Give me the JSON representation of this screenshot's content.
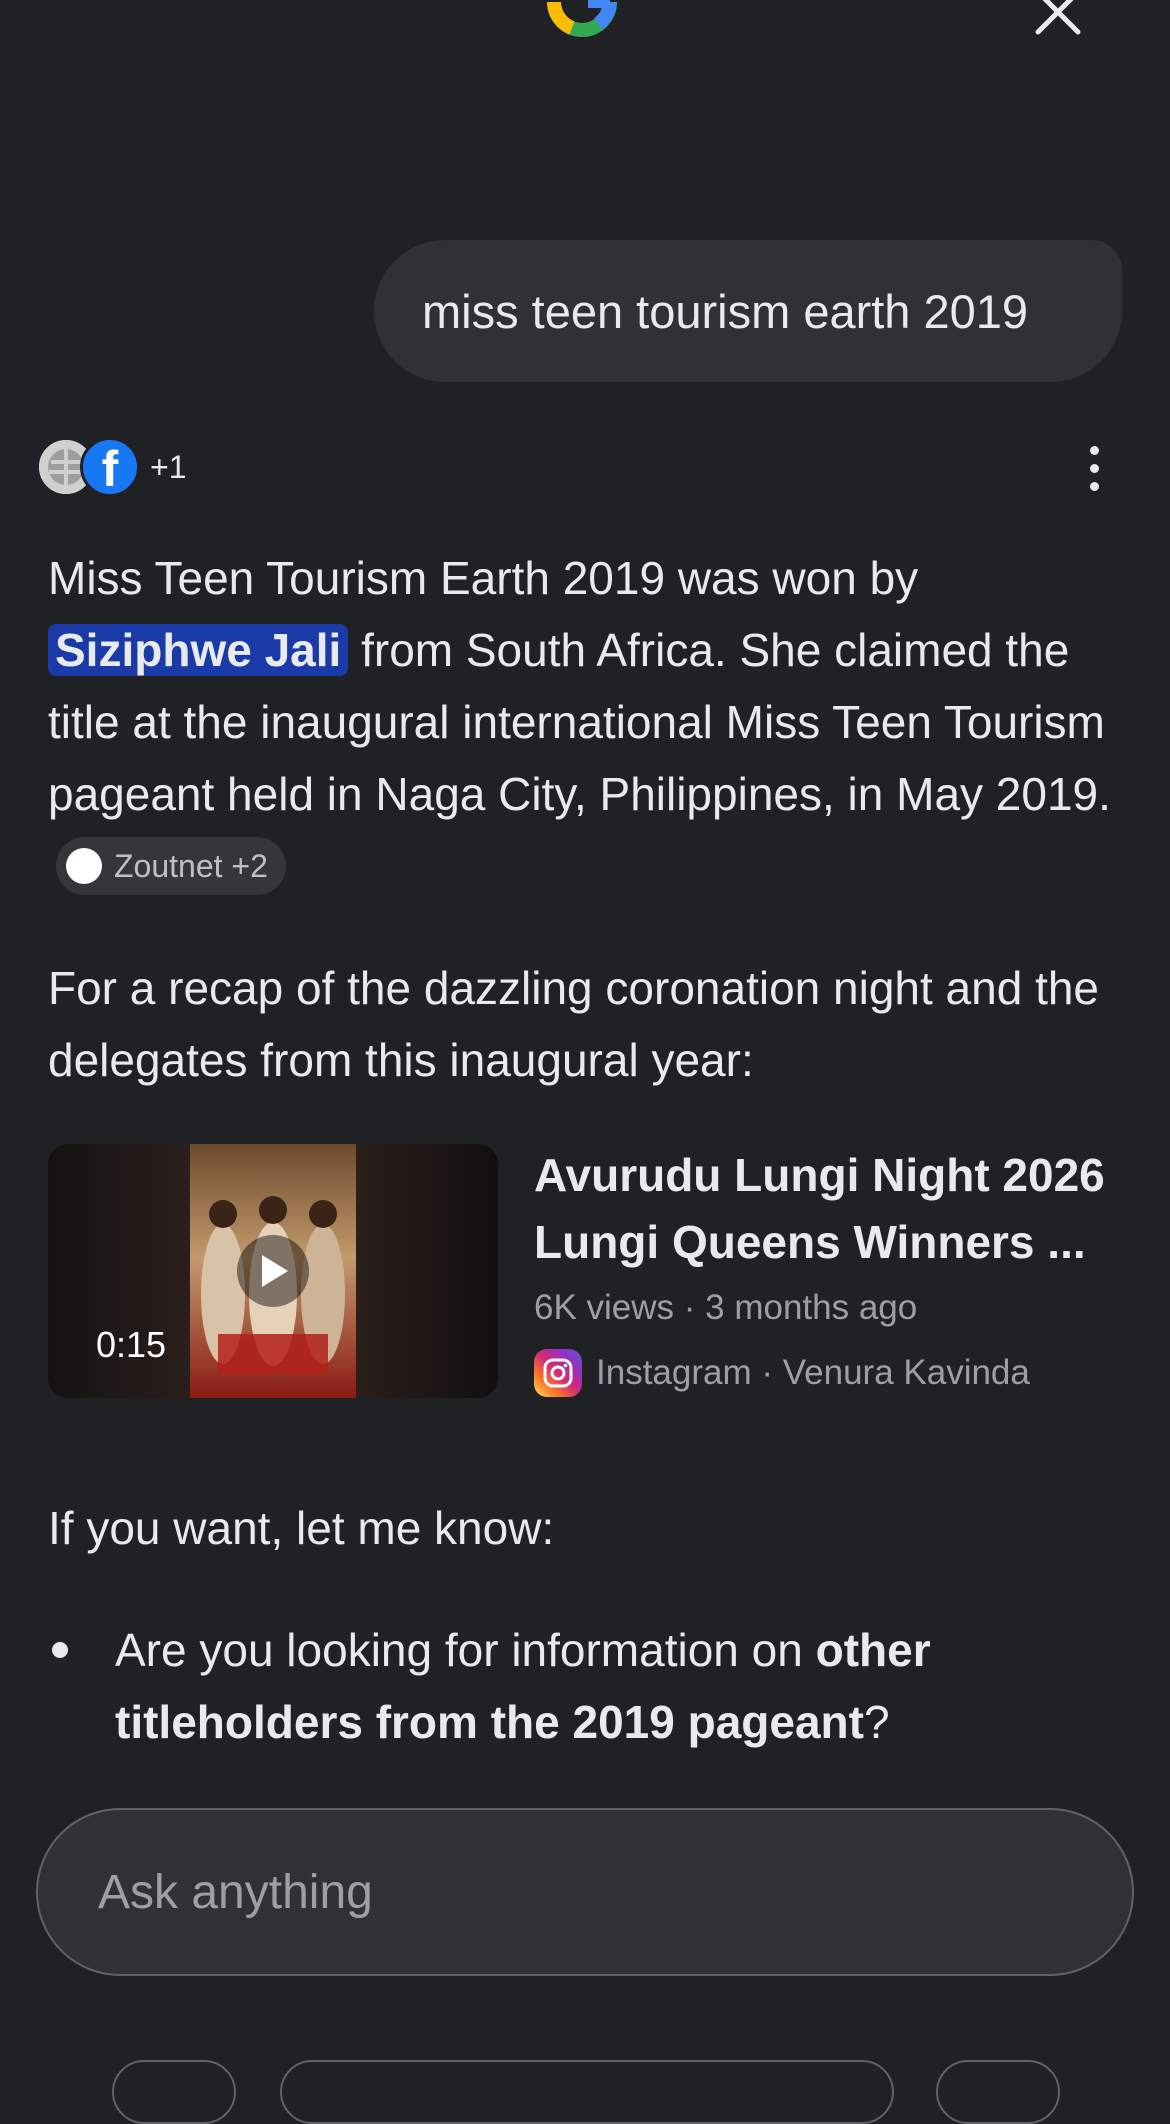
{
  "header": {
    "logo_icon": "google-g-logo",
    "close_icon": "close-icon"
  },
  "query": {
    "text": "miss teen tourism earth 2019"
  },
  "sources": {
    "avatars": [
      "globe-icon",
      "facebook-icon"
    ],
    "more_count": "+1",
    "menu_icon": "more-vert-icon"
  },
  "answer": {
    "p1_before": "Miss Teen Tourism Earth 2019 was won by",
    "p1_highlight": "Siziphwe Jali",
    "p1_after": " from South Africa. She claimed the title at the inaugural international Miss Teen Tourism pageant held in Naga City, Philippines, in May 2019.",
    "citation_chip": "Zoutnet +2",
    "p2": "For a recap of the dazzling coronation night and the delegates from this inaugural year:",
    "p3": "If you want, let me know:",
    "bullet_before": "Are you looking for information on ",
    "bullet_bold": "other titleholders from the 2019 pageant",
    "bullet_after": "?"
  },
  "video": {
    "duration": "0:15",
    "title": "Avurudu Lungi Night 2026 Lungi Queens Winners ...",
    "meta": "6K views · 3 months ago",
    "source": "Instagram · Venura Kavinda",
    "source_icon": "instagram-icon",
    "play_icon": "play-icon"
  },
  "input": {
    "placeholder": "Ask anything"
  },
  "colors": {
    "background": "#202124",
    "bubble": "#303134",
    "highlight": "#1a3aa8",
    "text": "#e8eaed",
    "muted": "#9aa0a6"
  }
}
